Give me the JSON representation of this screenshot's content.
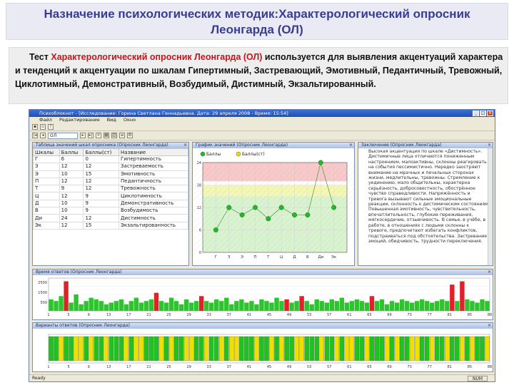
{
  "slide": {
    "title_line1": "Назначение психологических методик:Характерологический опросник",
    "title_line2": "Леонгарда (ОЛ)",
    "desc_prefix": "Тест ",
    "desc_highlight": "Характерологический опросник Леонгарда (ОЛ)",
    "desc_rest": " используется для выявления акцентуаций характера и тенденций к акцентуации по шкалам Гипертимный, Застревающий, Эмотивный, Педантичный, Тревожный, Циклотимный, Демонстративный, Возбудимый, Дистимный, Экзальтированный."
  },
  "app": {
    "window_title": "Психоблокнот - [Исследование: Горина Светлана Геннадьевна. Дата: 29 апреля 2008 - Время: 15:54]",
    "menu": [
      "Файл",
      "Редактирование",
      "Вид",
      "Окно"
    ],
    "toolbar_select": "ОЛ",
    "table_panel_title": "Таблица значений шкал опросника (Опросник Леонгарда)",
    "graph_panel_title": "График значений (Опросник Леонгарда)",
    "text_panel_title": "Заключение (Опросник Леонгарда)",
    "bars_panel_title": "Время ответов (Опросник Леонгарда)",
    "seg_panel_title": "Варианты ответов (Опросник Леонгарда)",
    "status": "Ready",
    "status_num": "NUM",
    "legend": [
      "Баллы",
      "Баллы(ст)"
    ],
    "table_headers": [
      "Шкалы",
      "Баллы",
      "Баллы(ст)",
      "Название"
    ],
    "table_rows": [
      [
        "Г",
        "6",
        "0",
        "Гипертимность"
      ],
      [
        "З",
        "12",
        "12",
        "Застреваемость"
      ],
      [
        "Э",
        "10",
        "15",
        "Эмотивность"
      ],
      [
        "П",
        "12",
        "12",
        "Педантичность"
      ],
      [
        "Т",
        "9",
        "12",
        "Тревожность"
      ],
      [
        "Ц",
        "12",
        "9",
        "Циклотимность"
      ],
      [
        "Д",
        "10",
        "9",
        "Демонстративность"
      ],
      [
        "В",
        "10",
        "9",
        "Возбудимость"
      ],
      [
        "Ди",
        "24",
        "12",
        "Дистимность"
      ],
      [
        "Эк",
        "12",
        "15",
        "Экзальтированность"
      ]
    ],
    "conclusion_text": "Высокая акцентуация по шкале «Дистимность». Дистимичные лица отличаются пониженным настроением, малоактивны, склонны реагировать на события пессимистично. Нередко заостряют внимание на мрачных и печальных сторонах жизни, медлительны, тревожны. Стремление к уединению, мало общительны, характерна серьёзность, добросовестность, обострённое чувство справедливости. Напряжённость и тревога вызывают сильные эмоциональные реакции, склонность к дистимическим состояниям. Повышенная эмотивность, чувствительность, впечатлительность, глубокие переживания, мягкосердечие, отзывчивость. В семье, в учёбе, в работе, в отношениях с людьми склонны к тревоге, предпочитают избегать конфликтов, подстраиваться под обстоятельства. Застревание эмоций, обидчивость, трудности переключения."
  },
  "chart_data": [
    {
      "type": "scatter",
      "title": "График значений (Опросник Леонгарда)",
      "categories": [
        "Г",
        "З",
        "Э",
        "П",
        "Т",
        "Ц",
        "Д",
        "В",
        "Ди",
        "Эк"
      ],
      "series": [
        {
          "name": "Баллы",
          "values": [
            6,
            12,
            10,
            12,
            9,
            12,
            10,
            10,
            24,
            12
          ]
        },
        {
          "name": "Баллы(ст)",
          "values": [
            0,
            12,
            15,
            12,
            12,
            9,
            9,
            9,
            12,
            15
          ]
        }
      ],
      "ylim": [
        0,
        24
      ],
      "bands": {
        "high": [
          19,
          24
        ],
        "tendency": [
          15,
          18
        ]
      },
      "grid": true
    },
    {
      "type": "bar",
      "title": "Время ответов (Опросник Леонгарда)",
      "x_ticks": [
        "1",
        "5",
        "9",
        "13",
        "17",
        "21",
        "25",
        "29",
        "33",
        "37",
        "41",
        "45",
        "49",
        "53",
        "57",
        "61",
        "65",
        "69",
        "73",
        "77",
        "81",
        "85",
        "88"
      ],
      "y_ticks": [
        "2500",
        "1500",
        "500"
      ],
      "values": [
        0.35,
        0.3,
        0.45,
        0.9,
        0.25,
        0.5,
        0.2,
        0.3,
        0.4,
        0.35,
        0.3,
        0.2,
        0.25,
        0.3,
        0.35,
        0.2,
        0.3,
        0.4,
        0.25,
        0.3,
        0.35,
        0.55,
        0.3,
        0.25,
        0.4,
        0.3,
        0.2,
        0.35,
        0.25,
        0.3,
        0.45,
        0.3,
        0.25,
        0.35,
        0.3,
        0.4,
        0.2,
        0.3,
        0.35,
        0.25,
        0.3,
        0.2,
        0.35,
        0.3,
        0.25,
        0.4,
        0.3,
        0.35,
        0.25,
        0.3,
        0.45,
        0.3,
        0.2,
        0.35,
        0.3,
        0.25,
        0.35,
        0.3,
        0.4,
        0.25,
        0.3,
        0.35,
        0.3,
        0.25,
        0.45,
        0.3,
        0.35,
        0.2,
        0.3,
        0.25,
        0.35,
        0.3,
        0.25,
        0.3,
        0.35,
        0.3,
        0.25,
        0.3,
        0.35,
        0.3,
        0.8,
        0.3,
        0.9,
        0.35,
        0.3,
        0.25,
        0.35,
        0.3
      ],
      "highlight_indices": [
        3,
        21,
        30,
        47,
        50,
        64,
        80,
        82
      ]
    },
    {
      "type": "bar",
      "title": "Варианты ответов (Опросник Леонгарда)",
      "x_ticks": [
        "1",
        "5",
        "9",
        "13",
        "17",
        "21",
        "25",
        "29",
        "33",
        "37",
        "41",
        "45",
        "49",
        "53",
        "57",
        "61",
        "65",
        "69",
        "73",
        "77",
        "81",
        "85",
        "88"
      ],
      "answers": [
        1,
        1,
        0,
        1,
        1,
        0,
        0,
        1,
        0,
        1,
        1,
        0,
        1,
        1,
        1,
        0,
        1,
        0,
        0,
        1,
        1,
        1,
        0,
        1,
        0,
        1,
        1,
        0,
        0,
        1,
        1,
        0,
        1,
        1,
        0,
        1,
        0,
        0,
        1,
        1,
        1,
        0,
        1,
        1,
        0,
        1,
        0,
        1,
        1,
        0,
        0,
        1,
        1,
        1,
        0,
        1,
        1,
        0,
        1,
        0,
        0,
        1,
        1,
        0,
        1,
        1,
        1,
        0,
        1,
        0,
        1,
        1,
        0,
        0,
        1,
        1,
        0,
        1,
        1,
        0,
        1,
        1,
        0,
        1,
        0,
        1,
        1,
        0
      ],
      "colors": {
        "yes": "#1fc21f",
        "no": "#f0e000"
      }
    }
  ]
}
